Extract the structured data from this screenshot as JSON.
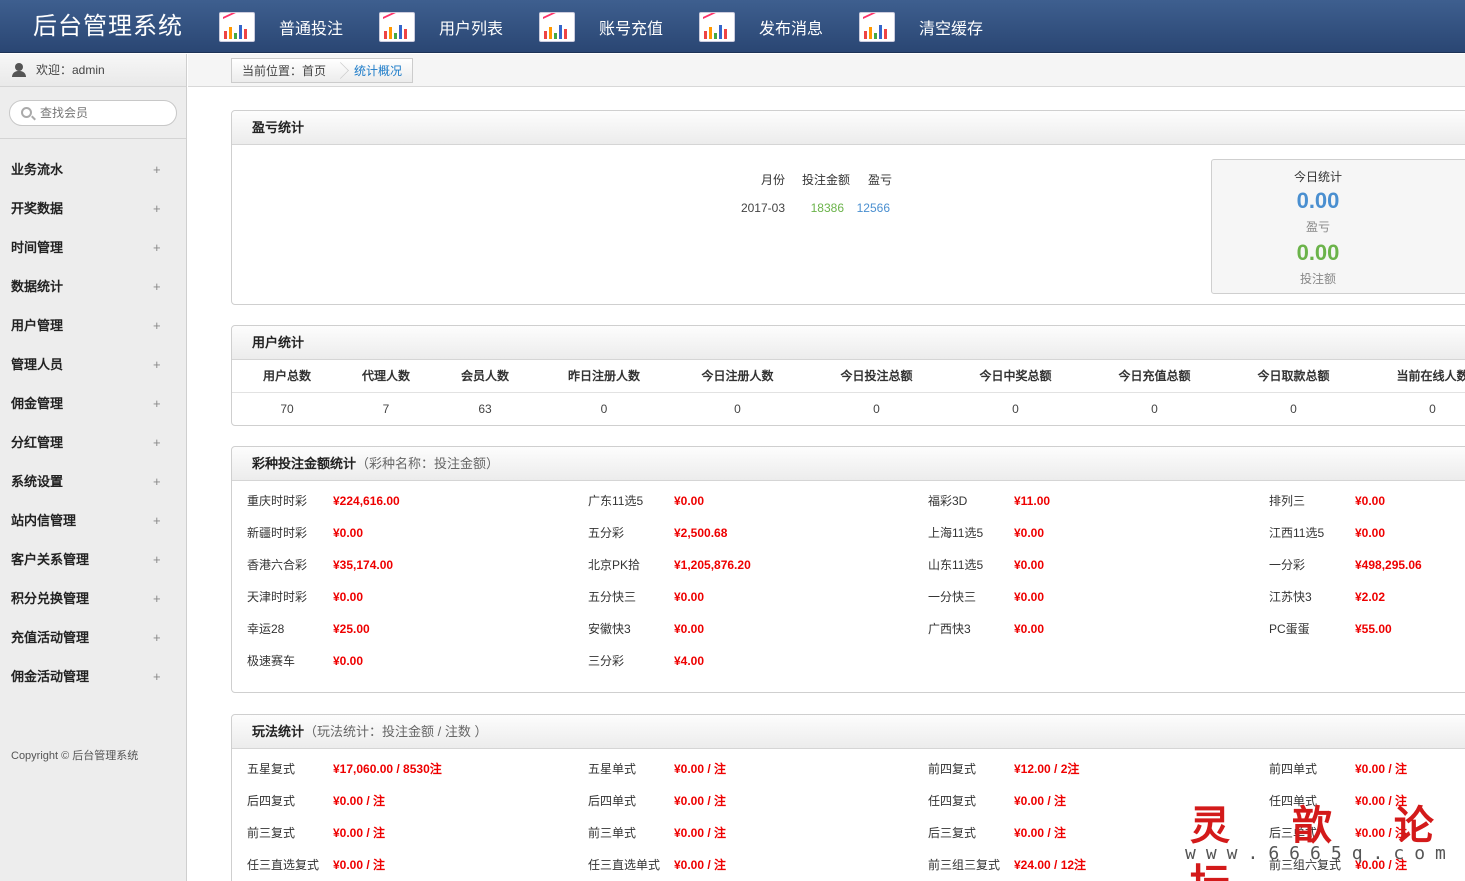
{
  "header": {
    "title": "后台管理系统",
    "nav": [
      {
        "label": "普通投注",
        "icon": "chart-icon"
      },
      {
        "label": "用户列表",
        "icon": "chart-icon"
      },
      {
        "label": "账号充值",
        "icon": "chart-icon"
      },
      {
        "label": "发布消息",
        "icon": "chart-icon"
      },
      {
        "label": "清空缓存",
        "icon": "chart-icon"
      }
    ]
  },
  "sidebar": {
    "welcome": "欢迎：admin",
    "search_placeholder": "查找会员",
    "items": [
      {
        "label": "业务流水"
      },
      {
        "label": "开奖数据"
      },
      {
        "label": "时间管理"
      },
      {
        "label": "数据统计"
      },
      {
        "label": "用户管理"
      },
      {
        "label": "管理人员"
      },
      {
        "label": "佣金管理"
      },
      {
        "label": "分红管理"
      },
      {
        "label": "系统设置"
      },
      {
        "label": "站内信管理"
      },
      {
        "label": "客户关系管理"
      },
      {
        "label": "积分兑换管理"
      },
      {
        "label": "充值活动管理"
      },
      {
        "label": "佣金活动管理"
      }
    ],
    "plus": "+",
    "copyright": "Copyright © 后台管理系统"
  },
  "breadcrumb": {
    "current": "当前位置：首页",
    "page": "统计概况"
  },
  "profit": {
    "title": "盈亏统计",
    "headers": [
      "月份",
      "投注金额",
      "盈亏"
    ],
    "row": {
      "month": "2017-03",
      "bet": "18386",
      "profit": "12566"
    },
    "today": {
      "title": "今日统计",
      "profit_value": "0.00",
      "profit_label": "盈亏",
      "bet_value": "0.00",
      "bet_label": "投注额"
    }
  },
  "users": {
    "title": "用户统计",
    "headers": [
      "用户总数",
      "代理人数",
      "会员人数",
      "昨日注册人数",
      "今日注册人数",
      "今日投注总额",
      "今日中奖总额",
      "今日充值总额",
      "今日取款总额",
      "当前在线人数"
    ],
    "values": [
      "70",
      "7",
      "63",
      "0",
      "0",
      "0",
      "0",
      "0",
      "0",
      "0"
    ]
  },
  "lottery": {
    "title": "彩种投注金额统计",
    "subtitle": "（彩种名称：投注金额）",
    "columns": [
      [
        {
          "name": "重庆时时彩",
          "value": "¥224,616.00"
        },
        {
          "name": "新疆时时彩",
          "value": "¥0.00"
        },
        {
          "name": "香港六合彩",
          "value": "¥35,174.00"
        },
        {
          "name": "天津时时彩",
          "value": "¥0.00"
        },
        {
          "name": "幸运28",
          "value": "¥25.00"
        },
        {
          "name": "极速赛车",
          "value": "¥0.00"
        }
      ],
      [
        {
          "name": "广东11选5",
          "value": "¥0.00"
        },
        {
          "name": "五分彩",
          "value": "¥2,500.68"
        },
        {
          "name": "北京PK拾",
          "value": "¥1,205,876.20"
        },
        {
          "name": "五分快三",
          "value": "¥0.00"
        },
        {
          "name": "安徽快3",
          "value": "¥0.00"
        },
        {
          "name": "三分彩",
          "value": "¥4.00"
        }
      ],
      [
        {
          "name": "福彩3D",
          "value": "¥11.00"
        },
        {
          "name": "上海11选5",
          "value": "¥0.00"
        },
        {
          "name": "山东11选5",
          "value": "¥0.00"
        },
        {
          "name": "一分快三",
          "value": "¥0.00"
        },
        {
          "name": "广西快3",
          "value": "¥0.00"
        }
      ],
      [
        {
          "name": "排列三",
          "value": "¥0.00"
        },
        {
          "name": "江西11选5",
          "value": "¥0.00"
        },
        {
          "name": "一分彩",
          "value": "¥498,295.06"
        },
        {
          "name": "江苏快3",
          "value": "¥2.02"
        },
        {
          "name": "PC蛋蛋",
          "value": "¥55.00"
        }
      ]
    ]
  },
  "playtype": {
    "title": "玩法统计",
    "subtitle": "（玩法统计：投注金额 / 注数 ）",
    "columns": [
      [
        {
          "name": "五星复式",
          "value": "¥17,060.00 / 8530注"
        },
        {
          "name": "后四复式",
          "value": "¥0.00 / 注"
        },
        {
          "name": "前三复式",
          "value": "¥0.00 / 注"
        },
        {
          "name": "任三直选复式",
          "value": "¥0.00 / 注"
        }
      ],
      [
        {
          "name": "五星单式",
          "value": "¥0.00 / 注"
        },
        {
          "name": "后四单式",
          "value": "¥0.00 / 注"
        },
        {
          "name": "前三单式",
          "value": "¥0.00 / 注"
        },
        {
          "name": "任三直选单式",
          "value": "¥0.00 / 注"
        }
      ],
      [
        {
          "name": "前四复式",
          "value": "¥12.00 / 2注"
        },
        {
          "name": "任四复式",
          "value": "¥0.00 / 注"
        },
        {
          "name": "后三复式",
          "value": "¥0.00 / 注"
        },
        {
          "name": "前三组三复式",
          "value": "¥24.00 / 12注"
        }
      ],
      [
        {
          "name": "前四单式",
          "value": "¥0.00 / 注"
        },
        {
          "name": "任四单式",
          "value": "¥0.00 / 注"
        },
        {
          "name": "后三单式",
          "value": "¥0.00 / 注"
        },
        {
          "name": "前三组六复式",
          "value": "¥0.00 / 注"
        }
      ]
    ]
  },
  "watermark": {
    "line1": "灵 歆 论 坛",
    "line2": "www.6665q.com"
  }
}
